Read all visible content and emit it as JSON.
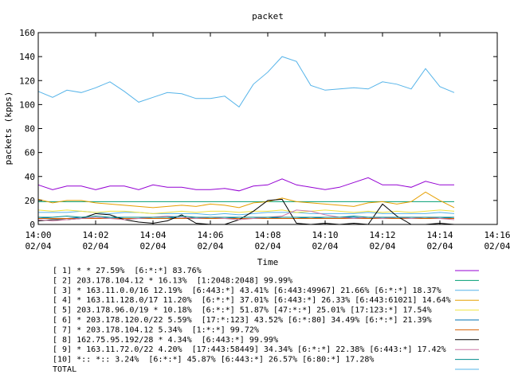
{
  "chart_data": {
    "type": "line",
    "title": "packet",
    "xlabel": "Time",
    "ylabel": "packets (kpps)",
    "ylim": [
      0,
      160
    ],
    "yticks": [
      0,
      20,
      40,
      60,
      80,
      100,
      120,
      140,
      160
    ],
    "xlim": [
      "14:00",
      "14:16"
    ],
    "xticks": [
      {
        "time": "14:00",
        "date": "02/04"
      },
      {
        "time": "14:02",
        "date": "02/04"
      },
      {
        "time": "14:04",
        "date": "02/04"
      },
      {
        "time": "14:06",
        "date": "02/04"
      },
      {
        "time": "14:08",
        "date": "02/04"
      },
      {
        "time": "14:10",
        "date": "02/04"
      },
      {
        "time": "14:12",
        "date": "02/04"
      },
      {
        "time": "14:14",
        "date": "02/04"
      },
      {
        "time": "14:16",
        "date": "02/04"
      }
    ],
    "legend_placement": "bottom",
    "x": [
      "14:00:00",
      "14:00:30",
      "14:01:00",
      "14:01:30",
      "14:02:00",
      "14:02:30",
      "14:03:00",
      "14:03:30",
      "14:04:00",
      "14:04:30",
      "14:05:00",
      "14:05:30",
      "14:06:00",
      "14:06:30",
      "14:07:00",
      "14:07:30",
      "14:08:00",
      "14:08:30",
      "14:09:00",
      "14:09:30",
      "14:10:00",
      "14:10:30",
      "14:11:00",
      "14:11:30",
      "14:12:00",
      "14:12:30",
      "14:13:00",
      "14:13:30",
      "14:14:00",
      "14:14:30"
    ],
    "series": [
      {
        "name": "[ 1] * * 27.59%  [6:*:*] 83.76%",
        "color": "#9400d3",
        "values": [
          33,
          29,
          32,
          32,
          29,
          32,
          32,
          29,
          33,
          31,
          31,
          29,
          29,
          30,
          28,
          32,
          33,
          38,
          33,
          31,
          29,
          31,
          35,
          39,
          33,
          33,
          31,
          36,
          33,
          33
        ]
      },
      {
        "name": "[ 2] 203.178.104.12 * 16.13%  [1:2048:2048] 99.99%",
        "color": "#009e73",
        "values": [
          19,
          19,
          19,
          19,
          19,
          19,
          19,
          19,
          19,
          19,
          19,
          19,
          19,
          19,
          19,
          19,
          19,
          19,
          19,
          19,
          19,
          19,
          19,
          19,
          19,
          19,
          19,
          19,
          19,
          19
        ]
      },
      {
        "name": "[ 3] * 163.11.0.0/16 12.19%  [6:443:*] 43.41% [6:443:49967] 21.66% [6:*:*] 18.37%",
        "color": "#56b4e9",
        "values": [
          10,
          10,
          10,
          11,
          10,
          9,
          10,
          10,
          9,
          9,
          9,
          9,
          8,
          9,
          8,
          9,
          10,
          10,
          10,
          9,
          9,
          9,
          9,
          10,
          9,
          9,
          9,
          9,
          10,
          9
        ]
      },
      {
        "name": "[ 4] * 163.11.128.0/17 11.20%  [6:*:*] 37.01% [6:443:*] 26.33% [6:443:61021] 14.64%",
        "color": "#e69f00",
        "values": [
          21,
          18,
          20,
          20,
          18,
          17,
          16,
          15,
          14,
          15,
          16,
          15,
          17,
          16,
          14,
          18,
          19,
          22,
          19,
          18,
          17,
          16,
          15,
          18,
          19,
          17,
          19,
          27,
          20,
          14
        ]
      },
      {
        "name": "[ 5] 203.178.96.0/19 * 10.18%  [6:*:*] 51.87% [47:*:*] 25.01% [17:123:*] 17.54%",
        "color": "#f0e442",
        "values": [
          12,
          11,
          12,
          11,
          10,
          11,
          11,
          10,
          9,
          10,
          11,
          10,
          11,
          11,
          10,
          11,
          11,
          12,
          10,
          11,
          12,
          11,
          10,
          11,
          10,
          11,
          10,
          11,
          12,
          11
        ]
      },
      {
        "name": "[ 6] * 203.178.120.0/22 5.59%  [17:*:123] 43.52% [6:*:80] 34.49% [6:*:*] 21.39%",
        "color": "#0072b2",
        "values": [
          6,
          5,
          5,
          6,
          5,
          6,
          5,
          5,
          6,
          6,
          5,
          6,
          5,
          5,
          6,
          6,
          5,
          6,
          6,
          5,
          6,
          6,
          6,
          5,
          6,
          5,
          6,
          6,
          5,
          6
        ]
      },
      {
        "name": "[ 7] * 203.178.104.12 5.34%  [1:*:*] 99.72%",
        "color": "#d55e00",
        "values": [
          5,
          5,
          5,
          5,
          5,
          5,
          5,
          5,
          5,
          5,
          5,
          5,
          5,
          5,
          5,
          5,
          5,
          5,
          5,
          5,
          5,
          5,
          5,
          5,
          5,
          5,
          5,
          5,
          5,
          5
        ]
      },
      {
        "name": "[ 8] 162.75.95.192/28 * 4.34%  [6:443:*] 99.99%",
        "color": "#000000",
        "values": [
          3,
          4,
          4,
          5,
          9,
          8,
          4,
          2,
          1,
          3,
          8,
          1,
          0,
          0,
          4,
          11,
          20,
          21,
          1,
          0,
          1,
          0,
          1,
          0,
          17,
          7,
          0,
          0,
          1,
          0
        ]
      },
      {
        "name": "[ 9] * 163.11.72.0/22 4.20%  [17:443:58449] 34.34% [6:*:*] 22.38% [6:443:*] 17.42%",
        "color": "#cc79a7",
        "values": [
          4,
          3,
          4,
          5,
          6,
          5,
          4,
          5,
          6,
          7,
          6,
          5,
          6,
          5,
          4,
          5,
          6,
          7,
          12,
          11,
          8,
          6,
          5,
          6,
          5,
          6,
          5,
          6,
          5,
          4
        ]
      },
      {
        "name": "[10] *:: *:: 3.24%  [6:*:*] 45.87% [6:443:*] 26.57% [6:80:*] 17.28%",
        "color": "#008b8b",
        "values": [
          6,
          6,
          7,
          6,
          7,
          6,
          6,
          6,
          6,
          6,
          7,
          6,
          6,
          6,
          6,
          6,
          6,
          6,
          6,
          6,
          6,
          6,
          7,
          6,
          6,
          6,
          6,
          6,
          6,
          6
        ]
      },
      {
        "name": "TOTAL",
        "color": "#56b4e9",
        "values": [
          111,
          106,
          112,
          110,
          114,
          119,
          111,
          102,
          106,
          110,
          109,
          105,
          105,
          107,
          98,
          117,
          127,
          140,
          136,
          116,
          112,
          113,
          114,
          113,
          119,
          117,
          113,
          130,
          115,
          110
        ]
      }
    ]
  }
}
